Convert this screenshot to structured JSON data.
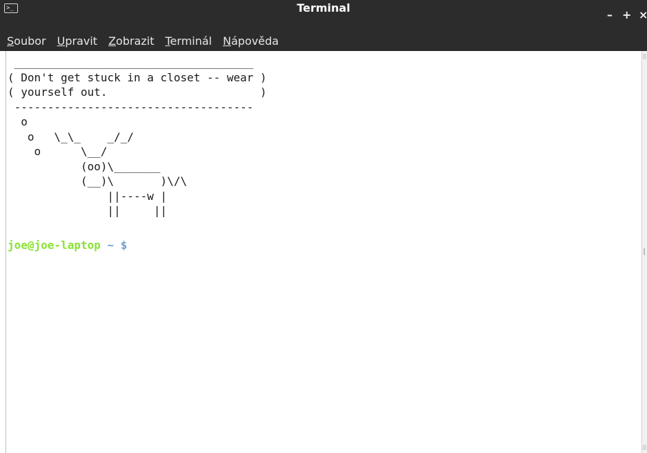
{
  "window": {
    "title": "Terminal",
    "app_icon": "terminal-icon",
    "app_icon_glyph": ">_",
    "controls": {
      "minimize": "–",
      "maximize": "+",
      "close": "×"
    }
  },
  "menu": {
    "items": [
      {
        "mnemonic": "S",
        "rest": "oubor"
      },
      {
        "mnemonic": "U",
        "rest": "pravit"
      },
      {
        "mnemonic": "Z",
        "rest": "obrazit"
      },
      {
        "mnemonic": "T",
        "rest": "erminál"
      },
      {
        "mnemonic": "N",
        "rest": "ápověda"
      }
    ]
  },
  "terminal": {
    "output_lines": [
      " ____________________________________",
      "( Don't get stuck in a closet -- wear )",
      "( yourself out.                       )",
      " ------------------------------------",
      "  o",
      "   o   \\_\\_    _/_/",
      "    o      \\__/",
      "           (oo)\\_______",
      "           (__)\\       )\\/\\",
      "               ||----w |",
      "               ||     ||"
    ],
    "prompt": {
      "user_host": "joe@joe-laptop",
      "path": "~",
      "symbol": "$"
    }
  },
  "colors": {
    "titlebar_bg": "#2c2c2c",
    "prompt_user": "#8ae234",
    "prompt_path": "#729fcf"
  }
}
